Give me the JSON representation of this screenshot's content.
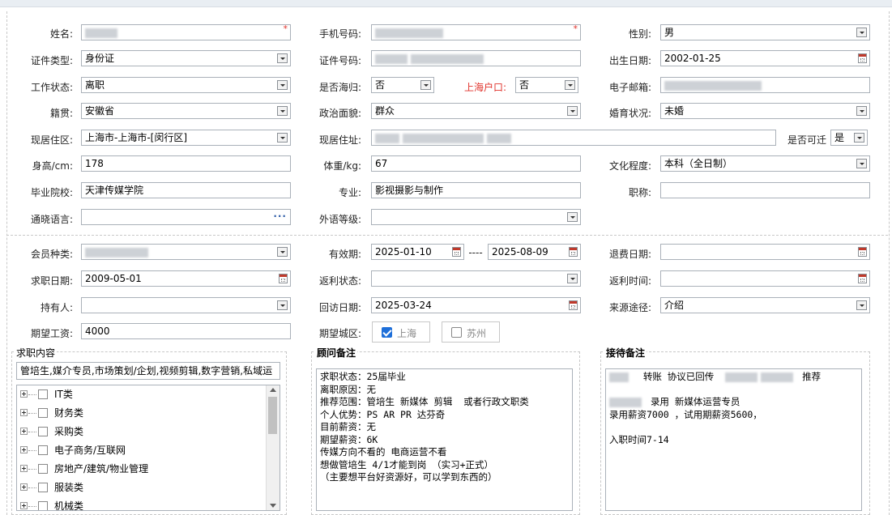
{
  "form": {
    "name": {
      "label": "姓名:",
      "required": "*"
    },
    "phone": {
      "label": "手机号码:",
      "required": "*"
    },
    "gender": {
      "label": "性别:",
      "value": "男"
    },
    "id_type": {
      "label": "证件类型:",
      "value": "身份证"
    },
    "id_no": {
      "label": "证件号码:"
    },
    "birth": {
      "label": "出生日期:",
      "value": "2002-01-25"
    },
    "work_status": {
      "label": "工作状态:",
      "value": "离职"
    },
    "returnee": {
      "label": "是否海归:",
      "value": "否"
    },
    "sh_hukou": {
      "label": "上海户口:",
      "value": "否"
    },
    "email": {
      "label": "电子邮箱:"
    },
    "native": {
      "label": "籍贯:",
      "value": "安徽省"
    },
    "political": {
      "label": "政治面貌:",
      "value": "群众"
    },
    "marital": {
      "label": "婚育状况:",
      "value": "未婚"
    },
    "residence_area": {
      "label": "现居住区:",
      "value": "上海市-上海市-[闵行区]"
    },
    "residence_addr": {
      "label": "现居住址:"
    },
    "relocatable": {
      "label": "是否可迁",
      "value": "是"
    },
    "height": {
      "label": "身高/cm:",
      "value": "178"
    },
    "weight": {
      "label": "体重/kg:",
      "value": "67"
    },
    "education": {
      "label": "文化程度:",
      "value": "本科（全日制）"
    },
    "school": {
      "label": "毕业院校:",
      "value": "天津传媒学院"
    },
    "major": {
      "label": "专业:",
      "value": "影视摄影与制作"
    },
    "title": {
      "label": "职称:",
      "value": ""
    },
    "language": {
      "label": "通晓语言:",
      "value": ""
    },
    "foreign_level": {
      "label": "外语等级:",
      "value": ""
    }
  },
  "membership": {
    "member_type": {
      "label": "会员种类:"
    },
    "validity": {
      "label": "有效期:",
      "start": "2025-01-10",
      "sep": "----",
      "end": "2025-08-09"
    },
    "refund_date": {
      "label": "退费日期:",
      "value": ""
    },
    "job_date": {
      "label": "求职日期:",
      "value": "2009-05-01"
    },
    "rebate_status": {
      "label": "返利状态:",
      "value": ""
    },
    "rebate_time": {
      "label": "返利时间:",
      "value": ""
    },
    "holder": {
      "label": "持有人:",
      "value": ""
    },
    "visit_date": {
      "label": "回访日期:",
      "value": "2025-03-24"
    },
    "source": {
      "label": "来源途径:",
      "value": "介绍"
    },
    "salary": {
      "label": "期望工资:",
      "value": "4000"
    },
    "city": {
      "label": "期望城区:",
      "options": [
        {
          "label": "上海",
          "checked": true
        },
        {
          "label": "苏州",
          "checked": false
        }
      ]
    }
  },
  "job_content": {
    "legend": "求职内容",
    "summary": "管培生,媒介专员,市场策划/企划,视频剪辑,数字营销,私域运",
    "tree": [
      "IT类",
      "财务类",
      "采购类",
      "电子商务/互联网",
      "房地产/建筑/物业管理",
      "服装类",
      "机械类"
    ]
  },
  "consultant_notes": {
    "legend": "顾问备注",
    "text": "求职状态：25届毕业\n离职原因：无\n推荐范围：管培生 新媒体 剪辑  或者行政文职类\n个人优势：PS AR PR 达芬奇\n目前薪资：无\n期望薪资：6K\n传媒方向不看的 电商运营不看\n想做管培生 4/1才能到岗 （实习+正式）\n（主要想平台好资源好，可以学到东西的）"
  },
  "reception_notes": {
    "legend": "接待备注",
    "line1_mid": "转账 协议已回传",
    "line1_end": "推荐",
    "line3": "录用  新媒体运营专员",
    "line4": "录用薪资7000 ，试用期薪资5600，",
    "line6": "入职时间7-14"
  }
}
